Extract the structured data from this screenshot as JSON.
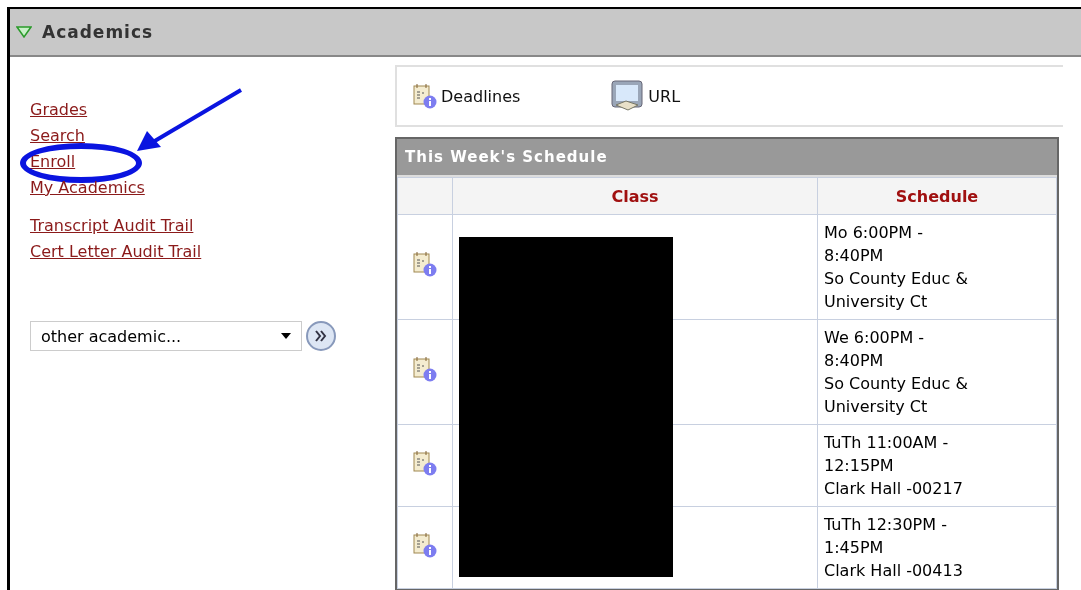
{
  "panel": {
    "title": "Academics",
    "expanded": true
  },
  "links": [
    {
      "label": "Grades"
    },
    {
      "label": "Search"
    },
    {
      "label": "Enroll",
      "annotated": true
    },
    {
      "label": "My Academics"
    }
  ],
  "audit_links": [
    {
      "label": "Transcript Audit Trail"
    },
    {
      "label": "Cert Letter Audit Trail"
    }
  ],
  "other_select": {
    "value": "other academic..."
  },
  "toolbar": [
    {
      "kind": "deadlines",
      "label": "Deadlines"
    },
    {
      "kind": "url",
      "label": "URL"
    }
  ],
  "schedule": {
    "title": "This Week's Schedule",
    "columns": [
      "Class",
      "Schedule"
    ],
    "rows": [
      {
        "schedule": [
          "Mo 6:00PM -",
          "8:40PM",
          "So County Educ &",
          "University Ct"
        ]
      },
      {
        "schedule": [
          "We 6:00PM -",
          "8:40PM",
          "So County Educ &",
          "University Ct"
        ]
      },
      {
        "schedule": [
          "TuTh 11:00AM -",
          "12:15PM",
          "Clark Hall -00217"
        ]
      },
      {
        "schedule": [
          "TuTh 12:30PM -",
          "1:45PM",
          "Clark Hall -00413"
        ]
      }
    ]
  }
}
